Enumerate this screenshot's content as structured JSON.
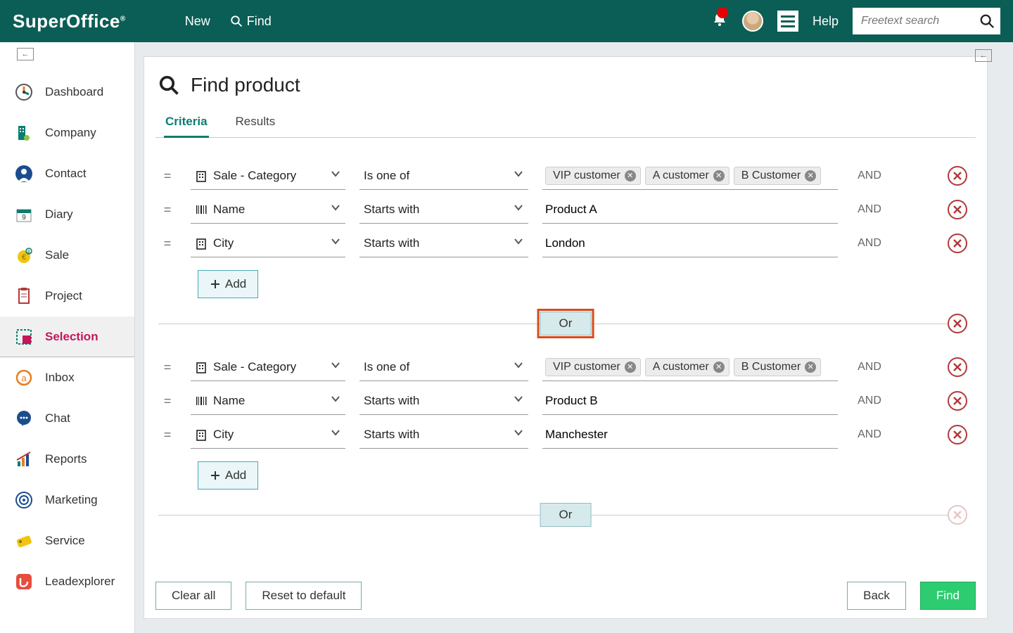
{
  "topbar": {
    "logo": "SuperOffice",
    "new_label": "New",
    "find_label": "Find",
    "help_label": "Help",
    "search_placeholder": "Freetext search"
  },
  "sidebar": {
    "items": [
      {
        "label": "Dashboard"
      },
      {
        "label": "Company"
      },
      {
        "label": "Contact"
      },
      {
        "label": "Diary"
      },
      {
        "label": "Sale"
      },
      {
        "label": "Project"
      },
      {
        "label": "Selection"
      },
      {
        "label": "Inbox"
      },
      {
        "label": "Chat"
      },
      {
        "label": "Reports"
      },
      {
        "label": "Marketing"
      },
      {
        "label": "Service"
      },
      {
        "label": "Leadexplorer"
      }
    ],
    "active_index": 6
  },
  "page": {
    "title": "Find product",
    "tabs": [
      {
        "label": "Criteria",
        "active": true
      },
      {
        "label": "Results",
        "active": false
      }
    ]
  },
  "groups": [
    {
      "rows": [
        {
          "field": "Sale - Category",
          "icon": "building",
          "op": "Is one of",
          "value_type": "chips",
          "chips": [
            "VIP customer",
            "A customer",
            "B Customer"
          ],
          "logic": "AND"
        },
        {
          "field": "Name",
          "icon": "barcode",
          "op": "Starts with",
          "value_type": "text",
          "value": "Product A",
          "logic": "AND"
        },
        {
          "field": "City",
          "icon": "building",
          "op": "Starts with",
          "value_type": "text",
          "value": "London",
          "logic": "AND"
        }
      ],
      "add_label": "Add"
    },
    {
      "rows": [
        {
          "field": "Sale - Category",
          "icon": "building",
          "op": "Is one of",
          "value_type": "chips",
          "chips": [
            "VIP customer",
            "A customer",
            "B Customer"
          ],
          "logic": "AND"
        },
        {
          "field": "Name",
          "icon": "barcode",
          "op": "Starts with",
          "value_type": "text",
          "value": "Product B",
          "logic": "AND"
        },
        {
          "field": "City",
          "icon": "building",
          "op": "Starts with",
          "value_type": "text",
          "value": "Manchester",
          "logic": "AND"
        }
      ],
      "add_label": "Add"
    }
  ],
  "separators": [
    {
      "label": "Or",
      "highlight": true,
      "removable": true
    },
    {
      "label": "Or",
      "highlight": false,
      "removable": false
    }
  ],
  "footer": {
    "clear_label": "Clear all",
    "reset_label": "Reset to default",
    "back_label": "Back",
    "find_label": "Find"
  }
}
